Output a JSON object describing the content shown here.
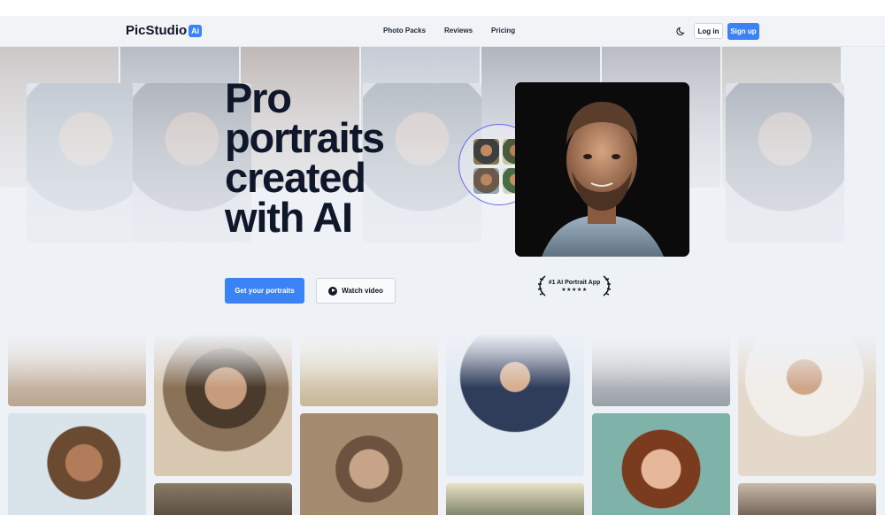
{
  "brand": {
    "name": "PicStudio",
    "badge": "Ai"
  },
  "nav": {
    "links": [
      "Photo Packs",
      "Reviews",
      "Pricing"
    ],
    "theme_toggle_icon": "moon-icon",
    "login_label": "Log in",
    "signup_label": "Sign up",
    "accent_color": "#3b82f6"
  },
  "hero": {
    "headline": "Pro portraits created with AI",
    "primary_cta": "Get your portraits",
    "secondary_cta": "Watch video",
    "award": {
      "title": "#1 AI Portrait App",
      "stars": "★★★★★"
    }
  }
}
